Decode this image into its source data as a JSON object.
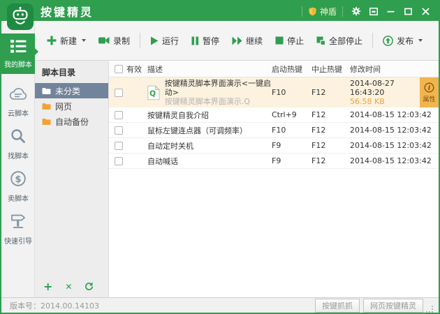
{
  "colors": {
    "brand_green": "#2f9e4f",
    "logo_green": "#1f8a41",
    "accent_orange": "#eba43c",
    "selected_row_bg": "#fcf2df",
    "dir_selected_bg": "#72849b",
    "badge_bg": "#f2b44e"
  },
  "titlebar": {
    "title": "按键精灵",
    "shield_badge": "神盾"
  },
  "toolbar": {
    "buttons": [
      {
        "label": "新建",
        "icon": "plus-icon",
        "dropdown": true
      },
      {
        "label": "录制",
        "icon": "camera-icon"
      },
      {
        "label": "运行",
        "icon": "play-icon"
      },
      {
        "label": "暂停",
        "icon": "pause-icon"
      },
      {
        "label": "继续",
        "icon": "fast-forward-icon"
      },
      {
        "label": "停止",
        "icon": "stop-icon"
      },
      {
        "label": "全部停止",
        "icon": "stop-all-icon"
      },
      {
        "label": "发布",
        "icon": "publish-icon",
        "dropdown": true
      }
    ]
  },
  "sidebar": {
    "items": [
      {
        "label": "我的脚本",
        "icon": "list-icon",
        "active": true
      },
      {
        "label": "云脚本",
        "icon": "cloud-icon"
      },
      {
        "label": "找脚本",
        "icon": "search-icon"
      },
      {
        "label": "卖脚本",
        "icon": "dollar-icon"
      },
      {
        "label": "快速引导",
        "icon": "signpost-icon"
      }
    ]
  },
  "directory": {
    "header": "脚本目录",
    "items": [
      {
        "label": "未分类",
        "selected": true
      },
      {
        "label": "网页",
        "selected": false
      },
      {
        "label": "自动备份",
        "selected": false
      }
    ]
  },
  "table": {
    "columns": {
      "valid": "有效",
      "desc": "描述",
      "start": "启动热键",
      "stop": "中止热键",
      "time": "修改时间"
    },
    "properties_label": "属性",
    "rows": [
      {
        "title": "按键精灵脚本界面演示<一键启动>",
        "subtitle": "按键精灵脚本界面演示.Q",
        "start": "F10",
        "stop": "F12",
        "time": "2014-08-27 16:43:20",
        "size": "56.58 KB",
        "selected": true
      },
      {
        "title": "按键精灵自我介绍",
        "start": "Ctrl+9",
        "stop": "F12",
        "time": "2014-08-15 12:03:42"
      },
      {
        "title": "鼠标左键连点器（可调频率）",
        "start": "F10",
        "stop": "F12",
        "time": "2014-08-15 12:03:42"
      },
      {
        "title": "自动定时关机",
        "start": "F9",
        "stop": "F12",
        "time": "2014-08-15 12:03:42"
      },
      {
        "title": "自动喊话",
        "start": "F9",
        "stop": "F12",
        "time": "2014-08-15 12:03:42"
      }
    ]
  },
  "statusbar": {
    "version": "版本号：2014.00.14103",
    "buttons": [
      "按键抓抓",
      "网页按键精灵"
    ]
  }
}
